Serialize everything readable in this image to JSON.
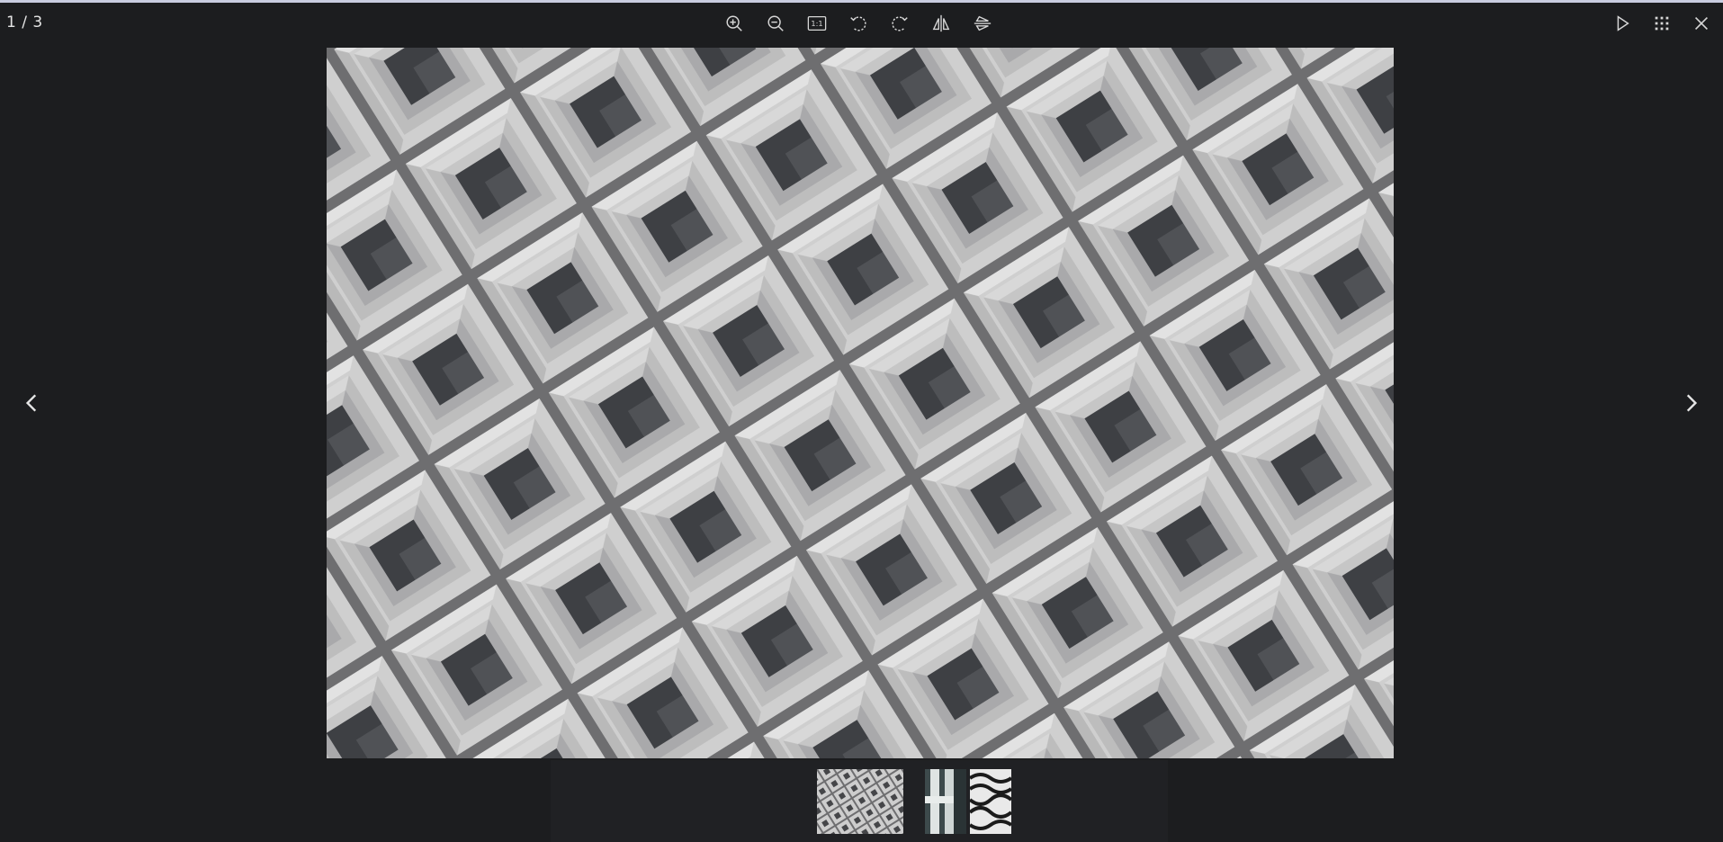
{
  "viewer": {
    "counter": "1 / 3",
    "toolbar": [
      {
        "name": "zoom-in-icon"
      },
      {
        "name": "zoom-out-icon"
      },
      {
        "name": "actual-size-icon",
        "label": "1:1"
      },
      {
        "name": "rotate-left-icon"
      },
      {
        "name": "rotate-right-icon"
      },
      {
        "name": "flip-horizontal-icon"
      },
      {
        "name": "flip-vertical-icon"
      }
    ],
    "right_tools": [
      {
        "name": "play-slideshow-icon"
      },
      {
        "name": "grid-view-icon"
      },
      {
        "name": "close-icon"
      }
    ],
    "nav": {
      "prev": "chevron-left-icon",
      "next": "chevron-right-icon"
    },
    "thumbnails": [
      {
        "name": "thumbnail-concrete-facade",
        "active": true
      },
      {
        "name": "thumbnail-white-sculpture",
        "active": false
      },
      {
        "name": "thumbnail-wavy-pattern",
        "active": false
      }
    ],
    "colors": {
      "background": "#1c1d1f",
      "icon": "#d7d7d7",
      "top_line": "#c9cde0"
    }
  }
}
